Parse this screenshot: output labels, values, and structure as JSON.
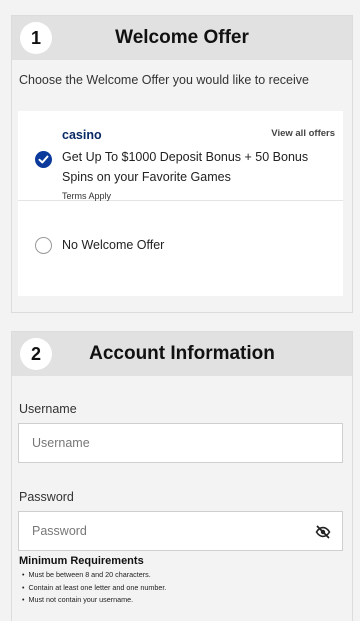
{
  "welcome": {
    "step": "1",
    "title": "Welcome Offer",
    "intro": "Choose the Welcome Offer you would like to receive",
    "offer": {
      "name": "casino",
      "view_all": "View all offers",
      "description": "Get Up To $1000 Deposit Bonus + 50 Bonus Spins on your Favorite Games",
      "terms": "Terms Apply",
      "selected": true
    },
    "no_offer": "No Welcome Offer"
  },
  "account": {
    "step": "2",
    "title": "Account Information",
    "username_label": "Username",
    "username_placeholder": "Username",
    "password_label": "Password",
    "password_placeholder": "Password",
    "requirements_title": "Minimum Requirements",
    "requirements": [
      "Must be between 8 and 20 characters.",
      "Contain at least one letter and one number.",
      "Must not contain your username."
    ]
  },
  "colors": {
    "accent": "#0b3a9c",
    "offer_name": "#0a2a66",
    "header_bg": "#e1e1e1"
  },
  "icons": {
    "checked": "checkmark-icon",
    "password_toggle": "eye-slash-icon"
  }
}
